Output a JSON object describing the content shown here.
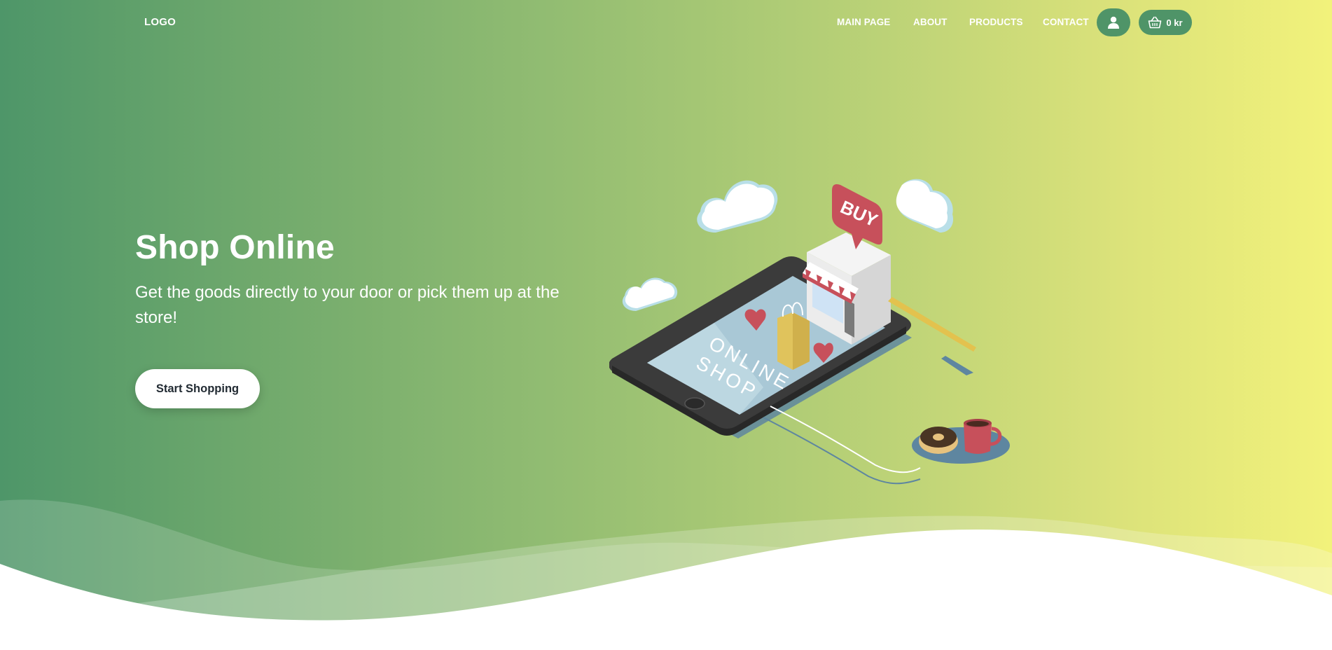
{
  "nav": {
    "logo": "LOGO",
    "links": [
      {
        "label": "MAIN PAGE"
      },
      {
        "label": "ABOUT"
      },
      {
        "label": "PRODUCTS"
      },
      {
        "label": "CONTACT"
      }
    ],
    "account_icon": "user-icon",
    "cart_icon": "basket-icon",
    "cart_total": "0 kr"
  },
  "hero": {
    "title": "Shop Online",
    "subtitle": "Get the goods directly to your door or pick them up at the store!",
    "cta_label": "Start Shopping"
  },
  "illustration": {
    "speech_bubble_text": "BUY",
    "screen_text_line1": "ONLINE",
    "screen_text_line2": "SHOP"
  },
  "colors": {
    "gradient_start": "#4e9669",
    "gradient_end": "#f2f27b",
    "button_accent": "#4f9468",
    "cta_text": "#222b33"
  }
}
